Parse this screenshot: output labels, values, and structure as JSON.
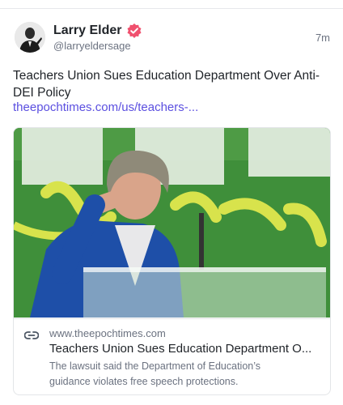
{
  "author": {
    "name": "Larry Elder",
    "handle": "@larryeldersage",
    "time": "7m"
  },
  "post": {
    "text": "Teachers Union Sues Education Department Over Anti-DEI Policy",
    "link": "theepochtimes.com/us/teachers-..."
  },
  "card": {
    "domain": "www.theepochtimes.com",
    "title": "Teachers Union Sues Education Department O...",
    "description": "The lawsuit said the Department of Education’s guidance violates free speech protections.",
    "image_icon": "press-conference-photo"
  },
  "colors": {
    "link": "#5b4fe0",
    "verified_badge": "#f0506e"
  }
}
